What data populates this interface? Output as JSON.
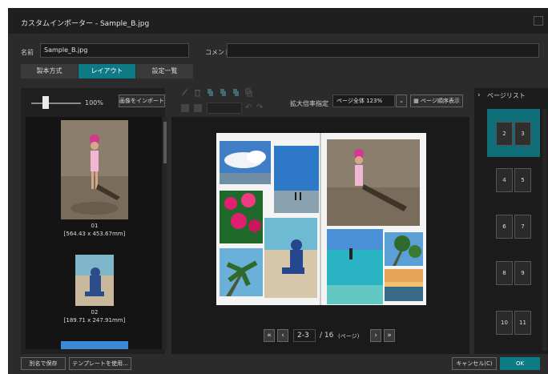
{
  "window": {
    "title": "カスタムインポーター - Sample_B.jpg"
  },
  "form": {
    "name_label": "名前",
    "name_value": "Sample_B.jpg",
    "comment_label": "コメント",
    "comment_value": ""
  },
  "tabs": [
    {
      "label": "製本方式"
    },
    {
      "label": "レイアウト"
    },
    {
      "label": "設定一覧"
    }
  ],
  "left_panel": {
    "zoom_percent": "100%",
    "import_button": "画像をインポート",
    "images": [
      {
        "index": "01",
        "size": "[564.43 x 453.67mm]"
      },
      {
        "index": "02",
        "size": "[189.71 x 247.91mm]"
      }
    ]
  },
  "toolbar": {
    "zoom_label": "拡大倍率指定",
    "zoom_value": "ページ全体 123%",
    "page_order_button": "ページ順序表示"
  },
  "pagination": {
    "current": "2-3",
    "total": "/ 16",
    "unit": "(ページ)"
  },
  "page_list": {
    "title": "ページリスト",
    "items": [
      {
        "left": "2",
        "right": "3"
      },
      {
        "left": "4",
        "right": "5"
      },
      {
        "left": "6",
        "right": "7"
      },
      {
        "left": "8",
        "right": "9"
      },
      {
        "left": "10",
        "right": "11"
      }
    ]
  },
  "footer": {
    "save_as_button": "別名で保存",
    "template_button": "テンプレートを使用...",
    "cancel_button": "キャンセル(C)",
    "ok_button": "OK"
  },
  "colors": {
    "accent": "#0e7a85",
    "window_bg": "#2b2b2b",
    "panel_bg": "#141414"
  }
}
